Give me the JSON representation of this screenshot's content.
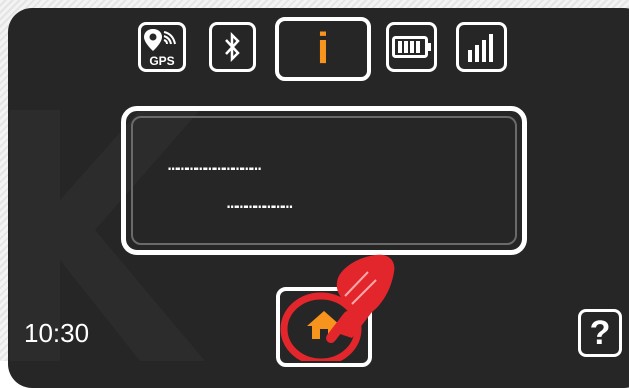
{
  "status_bar": {
    "gps_label": "GPS",
    "info_glyph": "i",
    "icons": [
      "gps-icon",
      "bluetooth-icon",
      "info-icon",
      "battery-icon",
      "signal-icon"
    ]
  },
  "display": {
    "line1": "…………………………",
    "line2": "…………………"
  },
  "footer": {
    "time": "10:30",
    "help_label": "?"
  },
  "colors": {
    "screen_bg": "#262626",
    "accent": "#f7941d",
    "pointer_red": "#e3262c",
    "outline": "#ffffff"
  }
}
